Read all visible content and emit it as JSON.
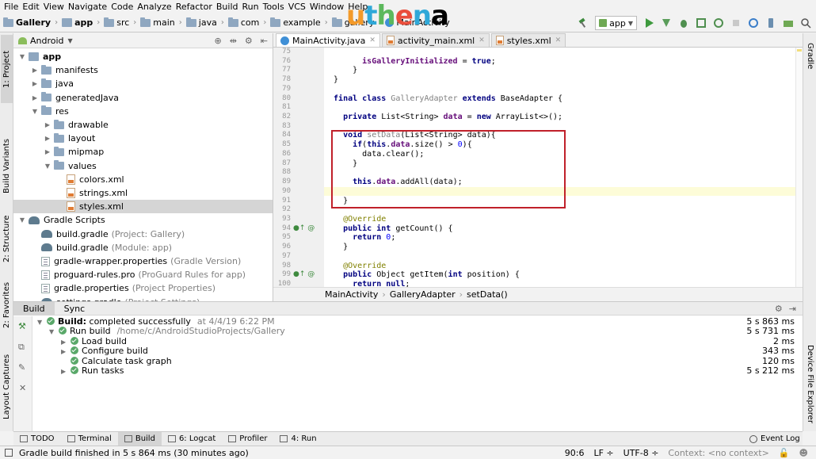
{
  "menu": [
    "File",
    "Edit",
    "View",
    "Navigate",
    "Code",
    "Analyze",
    "Refactor",
    "Build",
    "Run",
    "Tools",
    "VCS",
    "Window",
    "Help"
  ],
  "breadcrumb": [
    "Gallery",
    "app",
    "src",
    "main",
    "java",
    "com",
    "example",
    "gallery",
    "MainActivity"
  ],
  "logo": [
    "u",
    "t",
    "h",
    "e",
    "n",
    "a"
  ],
  "run_config": "app",
  "project_panel": {
    "view_mode": "Android",
    "tree": [
      {
        "label": "app",
        "suffix": "",
        "depth": 0,
        "arrow": "down",
        "icon": "app-module-icon",
        "bold": true
      },
      {
        "label": "manifests",
        "suffix": "",
        "depth": 1,
        "arrow": "right",
        "icon": "folder-icon"
      },
      {
        "label": "java",
        "suffix": "",
        "depth": 1,
        "arrow": "right",
        "icon": "folder-icon"
      },
      {
        "label": "generatedJava",
        "suffix": "",
        "depth": 1,
        "arrow": "right",
        "icon": "folder-icon"
      },
      {
        "label": "res",
        "suffix": "",
        "depth": 1,
        "arrow": "down",
        "icon": "folder-icon"
      },
      {
        "label": "drawable",
        "suffix": "",
        "depth": 2,
        "arrow": "right",
        "icon": "folder-icon"
      },
      {
        "label": "layout",
        "suffix": "",
        "depth": 2,
        "arrow": "right",
        "icon": "folder-icon"
      },
      {
        "label": "mipmap",
        "suffix": "",
        "depth": 2,
        "arrow": "right",
        "icon": "folder-icon"
      },
      {
        "label": "values",
        "suffix": "",
        "depth": 2,
        "arrow": "down",
        "icon": "folder-icon"
      },
      {
        "label": "colors.xml",
        "suffix": "",
        "depth": 3,
        "arrow": "",
        "icon": "xml-icon"
      },
      {
        "label": "strings.xml",
        "suffix": "",
        "depth": 3,
        "arrow": "",
        "icon": "xml-icon"
      },
      {
        "label": "styles.xml",
        "suffix": "",
        "depth": 3,
        "arrow": "",
        "icon": "xml-icon",
        "selected": true
      },
      {
        "label": "Gradle Scripts",
        "suffix": "",
        "depth": 0,
        "arrow": "down",
        "icon": "gradle-icon"
      },
      {
        "label": "build.gradle",
        "suffix": "(Project: Gallery)",
        "depth": 1,
        "arrow": "",
        "icon": "gradle-icon"
      },
      {
        "label": "build.gradle",
        "suffix": "(Module: app)",
        "depth": 1,
        "arrow": "",
        "icon": "gradle-icon"
      },
      {
        "label": "gradle-wrapper.properties",
        "suffix": "(Gradle Version)",
        "depth": 1,
        "arrow": "",
        "icon": "prop-icon"
      },
      {
        "label": "proguard-rules.pro",
        "suffix": "(ProGuard Rules for app)",
        "depth": 1,
        "arrow": "",
        "icon": "prop-icon"
      },
      {
        "label": "gradle.properties",
        "suffix": "(Project Properties)",
        "depth": 1,
        "arrow": "",
        "icon": "prop-icon"
      },
      {
        "label": "settings.gradle",
        "suffix": "(Project Settings)",
        "depth": 1,
        "arrow": "",
        "icon": "gradle-icon"
      }
    ]
  },
  "left_stripe": [
    "1: Project",
    "Build Variants",
    "2: Structure",
    "2: Favorites",
    "Layout Captures"
  ],
  "right_stripe": [
    "Gradle",
    "Device File Explorer"
  ],
  "editor": {
    "tabs": [
      {
        "label": "MainActivity.java",
        "icon": "java-icon",
        "active": true
      },
      {
        "label": "activity_main.xml",
        "icon": "xml-tab-icon",
        "active": false
      },
      {
        "label": "styles.xml",
        "icon": "xml-tab-icon",
        "active": false
      }
    ],
    "line_numbers": [
      "75",
      "76",
      "77",
      "78",
      "79",
      "80",
      "81",
      "82",
      "83",
      "84",
      "85",
      "86",
      "87",
      "88",
      "89",
      "90",
      "91",
      "92",
      "93",
      "94",
      "95",
      "96",
      "97",
      "98",
      "99",
      "100"
    ],
    "code_lines": [
      [
        {
          "t": ""
        }
      ],
      [
        {
          "t": "        isGalleryInitialized",
          "c": "fld"
        },
        {
          "t": " = "
        },
        {
          "t": "true",
          "c": "kw"
        },
        {
          "t": ";"
        }
      ],
      [
        {
          "t": "      }"
        }
      ],
      [
        {
          "t": "  }"
        }
      ],
      [
        {
          "t": ""
        }
      ],
      [
        {
          "t": "  final class ",
          "c": "kw"
        },
        {
          "t": "GalleryAdapter",
          "c": "gr"
        },
        {
          "t": " extends ",
          "c": "kw"
        },
        {
          "t": "BaseAdapter {"
        }
      ],
      [
        {
          "t": ""
        }
      ],
      [
        {
          "t": "    private ",
          "c": "kw"
        },
        {
          "t": "List<String> "
        },
        {
          "t": "data",
          "c": "fld"
        },
        {
          "t": " = "
        },
        {
          "t": "new ",
          "c": "kw"
        },
        {
          "t": "ArrayList<>();"
        }
      ],
      [
        {
          "t": ""
        }
      ],
      [
        {
          "t": "    void ",
          "c": "kw"
        },
        {
          "t": "setData",
          "c": "gr"
        },
        {
          "t": "(List<String> data){"
        }
      ],
      [
        {
          "t": "      if",
          "c": "kw"
        },
        {
          "t": "("
        },
        {
          "t": "this",
          "c": "kw"
        },
        {
          "t": "."
        },
        {
          "t": "data",
          "c": "fld"
        },
        {
          "t": ".size() > "
        },
        {
          "t": "0",
          "c": "mn"
        },
        {
          "t": "){"
        }
      ],
      [
        {
          "t": "        data.clear();"
        }
      ],
      [
        {
          "t": "      }"
        }
      ],
      [
        {
          "t": ""
        }
      ],
      [
        {
          "t": "      this",
          "c": "kw"
        },
        {
          "t": "."
        },
        {
          "t": "data",
          "c": "fld"
        },
        {
          "t": ".addAll(data);"
        }
      ],
      [
        {
          "t": ""
        }
      ],
      [
        {
          "t": "    }"
        }
      ],
      [
        {
          "t": ""
        }
      ],
      [
        {
          "t": "    @Override",
          "c": "ann"
        }
      ],
      [
        {
          "t": "    public int ",
          "c": "kw"
        },
        {
          "t": "getCount() {"
        }
      ],
      [
        {
          "t": "      return ",
          "c": "kw"
        },
        {
          "t": "0",
          "c": "mn"
        },
        {
          "t": ";"
        }
      ],
      [
        {
          "t": "    }"
        }
      ],
      [
        {
          "t": ""
        }
      ],
      [
        {
          "t": "    @Override",
          "c": "ann"
        }
      ],
      [
        {
          "t": "    public ",
          "c": "kw"
        },
        {
          "t": "Object getItem("
        },
        {
          "t": "int ",
          "c": "kw"
        },
        {
          "t": "position) {"
        }
      ],
      [
        {
          "t": "      return null",
          "c": "kw"
        },
        {
          "t": ";"
        }
      ]
    ],
    "current_line": "90",
    "breadcrumb": [
      "MainActivity",
      "GalleryAdapter",
      "setData()"
    ]
  },
  "build": {
    "tabs": [
      "Build",
      "Sync"
    ],
    "rows": [
      {
        "depth": 0,
        "arrow": "down",
        "label": "Build:",
        "bold": true,
        "text": " completed successfully",
        "meta": "at 4/4/19 6:22 PM",
        "time": "5 s 863 ms"
      },
      {
        "depth": 1,
        "arrow": "down",
        "label": "Run build",
        "bold": false,
        "text": "",
        "meta": "/home/c/AndroidStudioProjects/Gallery",
        "time": "5 s 731 ms"
      },
      {
        "depth": 2,
        "arrow": "right",
        "label": "Load build",
        "bold": false,
        "text": "",
        "meta": "",
        "time": "2 ms"
      },
      {
        "depth": 2,
        "arrow": "right",
        "label": "Configure build",
        "bold": false,
        "text": "",
        "meta": "",
        "time": "343 ms"
      },
      {
        "depth": 2,
        "arrow": "",
        "label": "Calculate task graph",
        "bold": false,
        "text": "",
        "meta": "",
        "time": "120 ms"
      },
      {
        "depth": 2,
        "arrow": "right",
        "label": "Run tasks",
        "bold": false,
        "text": "",
        "meta": "",
        "time": "5 s 212 ms"
      }
    ]
  },
  "tool_tabs": [
    {
      "label": "TODO",
      "icon": "todo-icon"
    },
    {
      "label": "Terminal",
      "icon": "terminal-icon"
    },
    {
      "label": "Build",
      "icon": "hammer-icon",
      "active": true
    },
    {
      "label": "6: Logcat",
      "icon": "logcat-icon"
    },
    {
      "label": "Profiler",
      "icon": "profiler-icon"
    },
    {
      "label": "4: Run",
      "icon": "run-icon"
    }
  ],
  "event_log": "Event Log",
  "status": {
    "message": "Gradle build finished in 5 s 864 ms (30 minutes ago)",
    "position": "90:6",
    "line_separator": "LF ÷",
    "encoding": "UTF-8 ÷",
    "context_label": "Context:",
    "context_value": "<no context>"
  }
}
